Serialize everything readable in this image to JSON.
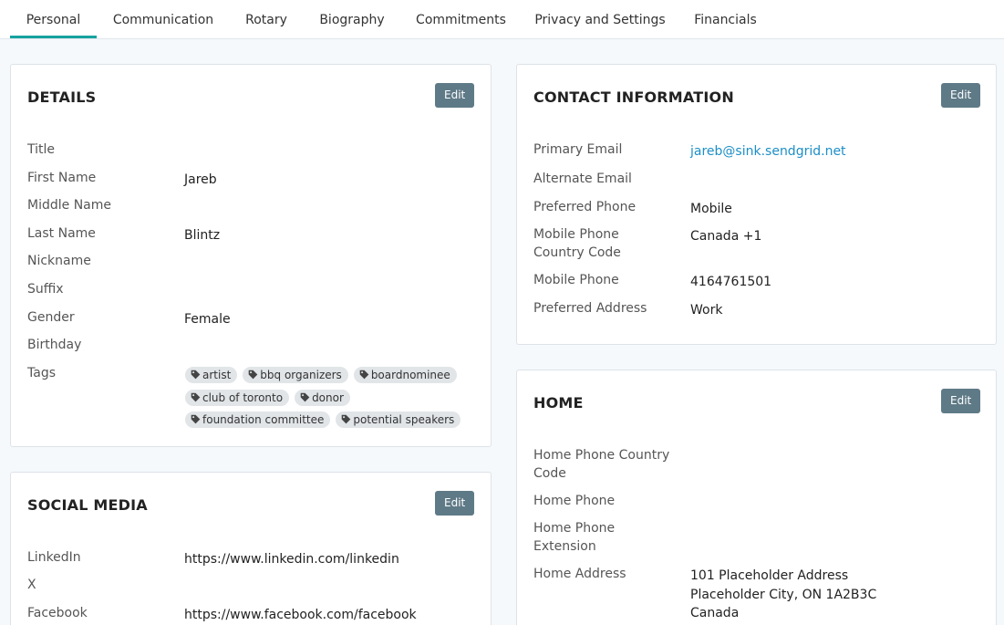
{
  "tabs": [
    "Personal",
    "Communication",
    "Rotary",
    "Biography",
    "Commitments",
    "Privacy and Settings",
    "Financials"
  ],
  "edit_label": "Edit",
  "details": {
    "title": "DETAILS",
    "fields": [
      {
        "label": "Title",
        "value": ""
      },
      {
        "label": "First Name",
        "value": "Jareb"
      },
      {
        "label": "Middle Name",
        "value": ""
      },
      {
        "label": "Last Name",
        "value": "Blintz"
      },
      {
        "label": "Nickname",
        "value": ""
      },
      {
        "label": "Suffix",
        "value": ""
      },
      {
        "label": "Gender",
        "value": "Female"
      },
      {
        "label": "Birthday",
        "value": ""
      }
    ],
    "tags_label": "Tags",
    "tags": [
      "artist",
      "bbq organizers",
      "boardnominee",
      "club of toronto",
      "donor",
      "foundation committee",
      "potential speakers"
    ]
  },
  "social": {
    "title": "SOCIAL MEDIA",
    "fields": [
      {
        "label": "LinkedIn",
        "value": "https://www.linkedin.com/linkedin"
      },
      {
        "label": "X",
        "value": ""
      },
      {
        "label": "Facebook",
        "value": "https://www.facebook.com/facebook"
      }
    ]
  },
  "contact": {
    "title": "CONTACT INFORMATION",
    "fields": [
      {
        "label": "Primary Email",
        "value": "jareb@sink.sendgrid.net"
      },
      {
        "label": "Alternate Email",
        "value": ""
      },
      {
        "label": "Preferred Phone",
        "value": "Mobile"
      },
      {
        "label": "Mobile Phone Country Code",
        "value": "Canada +1"
      },
      {
        "label": "Mobile Phone",
        "value": "4164761501"
      },
      {
        "label": "Preferred Address",
        "value": "Work"
      }
    ]
  },
  "home": {
    "title": "HOME",
    "fields": [
      {
        "label": "Home Phone Country Code",
        "value": ""
      },
      {
        "label": "Home Phone",
        "value": ""
      },
      {
        "label": "Home Phone Extension",
        "value": ""
      },
      {
        "label": "Home Address",
        "value": [
          "101 Placeholder Address",
          "Placeholder City, ON 1A2B3C",
          "Canada"
        ]
      }
    ]
  },
  "colors": {
    "accent": "#17a2a0",
    "button": "#5f7a87",
    "link": "#1c8fc7"
  }
}
